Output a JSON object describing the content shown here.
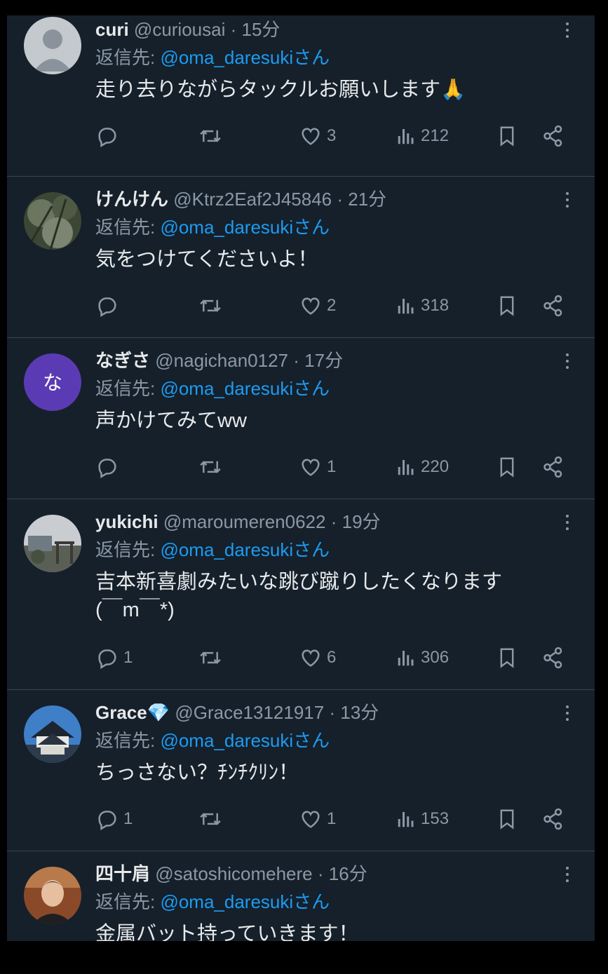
{
  "replies": [
    {
      "name": "curi",
      "handle": "@curiousai",
      "sep": "·",
      "time": "15分",
      "reply_prefix": "返信先: ",
      "mention": "@oma_daresukiさん",
      "text": "走り去りながらタックルお願いします🙏",
      "reply_count": "",
      "like_count": "3",
      "view_count": "212",
      "avatar": "default-avatar"
    },
    {
      "name": "けんけん",
      "handle": "@Ktrz2Eaf2J45846",
      "sep": "·",
      "time": "21分",
      "reply_prefix": "返信先: ",
      "mention": "@oma_daresukiさん",
      "text": "気をつけてくださいよ！",
      "reply_count": "",
      "like_count": "2",
      "view_count": "318",
      "avatar": "tree-photo"
    },
    {
      "name": "なぎさ",
      "handle": "@nagichan0127",
      "sep": "·",
      "time": "17分",
      "reply_prefix": "返信先: ",
      "mention": "@oma_daresukiさん",
      "text": "声かけてみてww",
      "reply_count": "",
      "like_count": "1",
      "view_count": "220",
      "avatar": "letter-avatar",
      "avatar_letter": "な",
      "avatar_color": "#5b3bb3"
    },
    {
      "name": "yukichi",
      "handle": "@maroumeren0622",
      "sep": "·",
      "time": "19分",
      "reply_prefix": "返信先: ",
      "mention": "@oma_daresukiさん",
      "text": "吉本新喜劇みたいな跳び蹴りしたくなります",
      "text2": "(￣m￣*)",
      "reply_count": "1",
      "like_count": "6",
      "view_count": "306",
      "avatar": "shrine-photo"
    },
    {
      "name": "Grace💎",
      "handle": "@Grace13121917",
      "sep": "·",
      "time": "13分",
      "reply_prefix": "返信先: ",
      "mention": "@oma_daresukiさん",
      "text": "ちっさない？ﾁﾝﾁｸﾘﾝ！",
      "reply_count": "1",
      "like_count": "1",
      "view_count": "153",
      "avatar": "castle-photo"
    },
    {
      "name": "四十肩",
      "handle": "@satoshicomehere",
      "sep": "·",
      "time": "16分",
      "reply_prefix": "返信先: ",
      "mention": "@oma_daresukiさん",
      "text": "金属バット持っていきます！",
      "avatar": "person-photo"
    }
  ],
  "colors": {
    "background": "#15202b",
    "text": "#e7e9ea",
    "muted": "#8b98a5",
    "link": "#1d9bf0",
    "divider": "#38444d"
  }
}
